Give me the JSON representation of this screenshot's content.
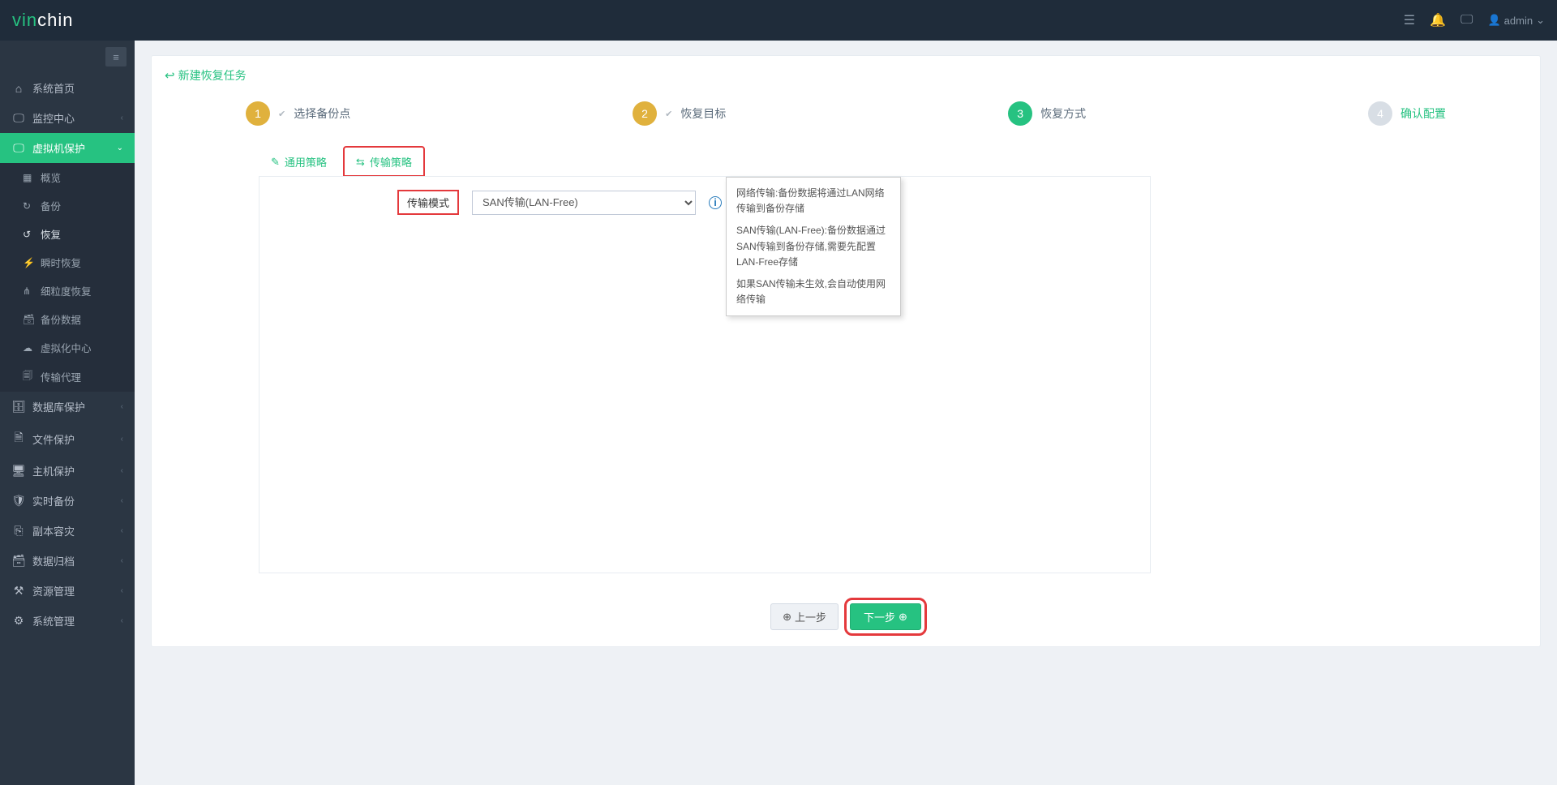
{
  "header": {
    "brand_prefix": "vin",
    "brand_suffix": "chin",
    "user_label": "admin"
  },
  "sidebar": {
    "items": [
      {
        "icon": "⌂",
        "label": "系统首页"
      },
      {
        "icon": "🖵",
        "label": "监控中心",
        "arrow": "‹"
      },
      {
        "icon": "🖵",
        "label": "虚拟机保护",
        "arrow": "⌄"
      },
      {
        "icon": "🗄",
        "label": "数据库保护",
        "arrow": "‹"
      },
      {
        "icon": "🗎",
        "label": "文件保护",
        "arrow": "‹"
      },
      {
        "icon": "🖥",
        "label": "主机保护",
        "arrow": "‹"
      },
      {
        "icon": "🛡",
        "label": "实时备份",
        "arrow": "‹"
      },
      {
        "icon": "⎘",
        "label": "副本容灾",
        "arrow": "‹"
      },
      {
        "icon": "🗃",
        "label": "数据归档",
        "arrow": "‹"
      },
      {
        "icon": "⚒",
        "label": "资源管理",
        "arrow": "‹"
      },
      {
        "icon": "⚙",
        "label": "系统管理",
        "arrow": "‹"
      }
    ],
    "submenu": [
      {
        "icon": "▦",
        "label": "概览"
      },
      {
        "icon": "↻",
        "label": "备份"
      },
      {
        "icon": "↺",
        "label": "恢复"
      },
      {
        "icon": "⚡",
        "label": "瞬时恢复"
      },
      {
        "icon": "⋔",
        "label": "细粒度恢复"
      },
      {
        "icon": "🗃",
        "label": "备份数据"
      },
      {
        "icon": "☁",
        "label": "虚拟化中心"
      },
      {
        "icon": "🗐",
        "label": "传输代理"
      }
    ]
  },
  "page": {
    "title": "新建恢复任务",
    "steps": [
      {
        "num": "1",
        "label": "选择备份点"
      },
      {
        "num": "2",
        "label": "恢复目标"
      },
      {
        "num": "3",
        "label": "恢复方式"
      },
      {
        "num": "4",
        "label": "确认配置"
      }
    ],
    "tabs": [
      {
        "icon": "✎",
        "label": "通用策略"
      },
      {
        "icon": "⇆",
        "label": "传输策略"
      }
    ],
    "form": {
      "mode_label": "传输模式",
      "mode_value": "SAN传输(LAN-Free)"
    },
    "tooltip": {
      "p1": "网络传输:备份数据将通过LAN网络传输到备份存储",
      "p2": "SAN传输(LAN-Free):备份数据通过SAN传输到备份存储,需要先配置LAN-Free存储",
      "p3": "如果SAN传输未生效,会自动使用网络传输"
    },
    "buttons": {
      "prev": "上一步",
      "next": "下一步"
    }
  }
}
